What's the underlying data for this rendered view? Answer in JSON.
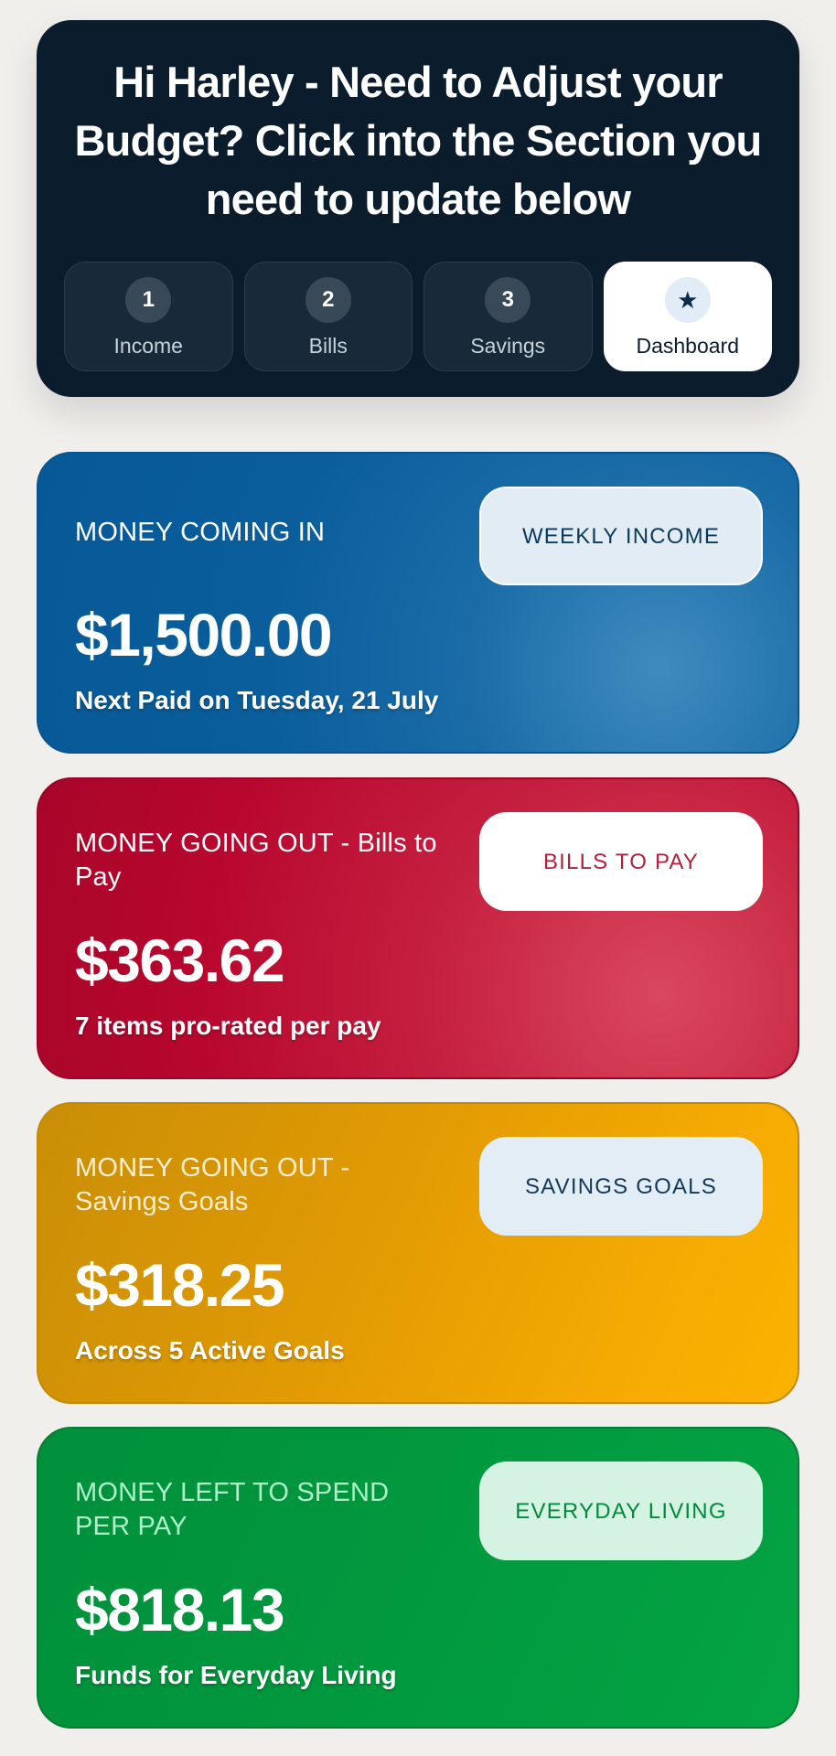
{
  "header": {
    "title": "Hi Harley - Need to Adjust your Budget? Click into the Section you need to update below",
    "tabs": [
      {
        "badge": "1",
        "label": "Income"
      },
      {
        "badge": "2",
        "label": "Bills"
      },
      {
        "badge": "3",
        "label": "Savings"
      },
      {
        "badge": "★",
        "icon": "star-icon",
        "label": "Dashboard",
        "active": true
      }
    ]
  },
  "cards": {
    "income": {
      "label": "MONEY COMING IN",
      "amount": "$1,500.00",
      "subtext": "Next Paid on Tuesday, 21 July",
      "button": "WEEKLY INCOME",
      "color": "#0a5e9c"
    },
    "bills": {
      "label": "MONEY GOING OUT - Bills to Pay",
      "amount": "$363.62",
      "subtext": "7 items pro-rated per pay",
      "button": "BILLS TO PAY",
      "color": "#b8072e"
    },
    "savings": {
      "label": "MONEY GOING OUT - Savings Goals",
      "amount": "$318.25",
      "subtext": "Across 5 Active Goals",
      "button": "SAVINGS GOALS",
      "color": "#e29b03"
    },
    "living": {
      "label": "MONEY LEFT TO SPEND PER PAY",
      "amount": "$818.13",
      "subtext": "Funds for Everyday Living",
      "button": "EVERYDAY LIVING",
      "color": "#01993e"
    }
  }
}
